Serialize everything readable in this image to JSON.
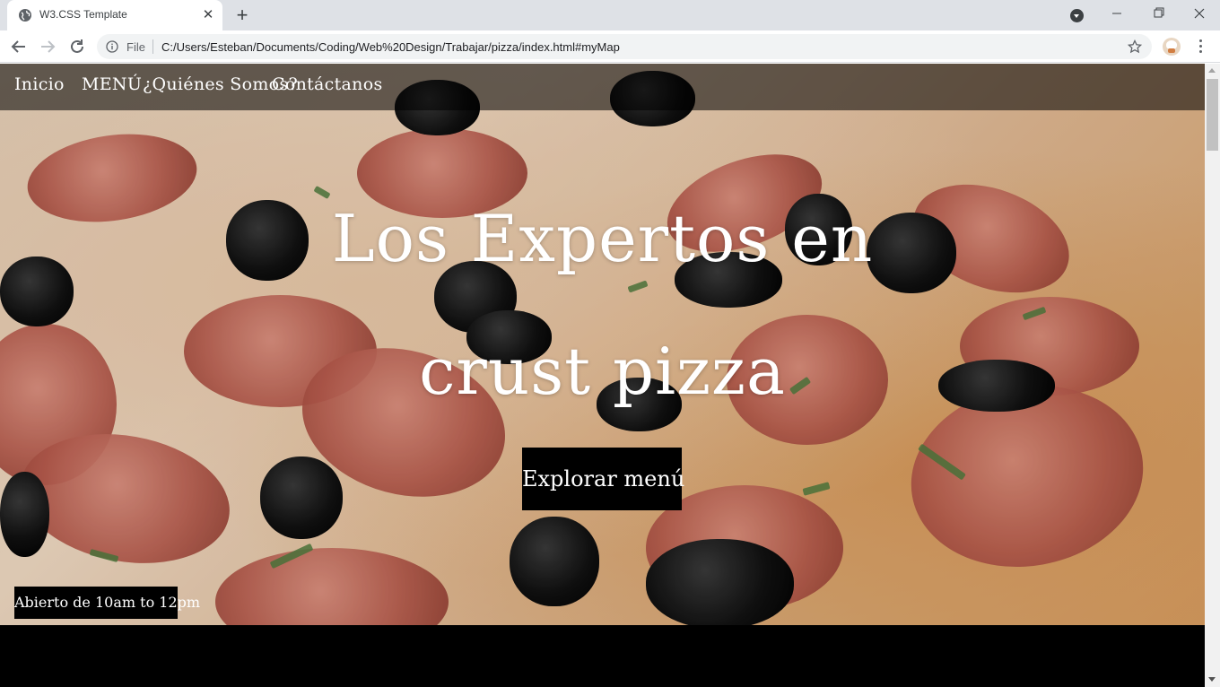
{
  "browser": {
    "tab_title": "W3.CSS Template",
    "url_scheme": "File",
    "url": "C:/Users/Esteban/Documents/Coding/Web%20Design/Trabajar/pizza/index.html#myMap"
  },
  "icons": {
    "tab_favicon": "globe-icon",
    "tab_close": "close-icon",
    "new_tab": "plus-icon",
    "back": "arrow-left-icon",
    "forward": "arrow-right-icon",
    "reload": "reload-icon",
    "site_info": "info-icon",
    "bookmark": "star-icon",
    "menu": "more-vertical-icon"
  },
  "nav": {
    "items": [
      "Inicio",
      "MENÚ",
      "¿Quiénes Somos?",
      "Contáctanos"
    ]
  },
  "hero": {
    "title_line1": "Los Expertos en",
    "title_line2": "crust pizza",
    "cta": "Explorar menú",
    "hours": "Abierto de 10am to 12pm"
  },
  "colors": {
    "navbar_bg": "#000000",
    "button_bg": "#000000",
    "text": "#ffffff",
    "section_bg": "#000000"
  }
}
